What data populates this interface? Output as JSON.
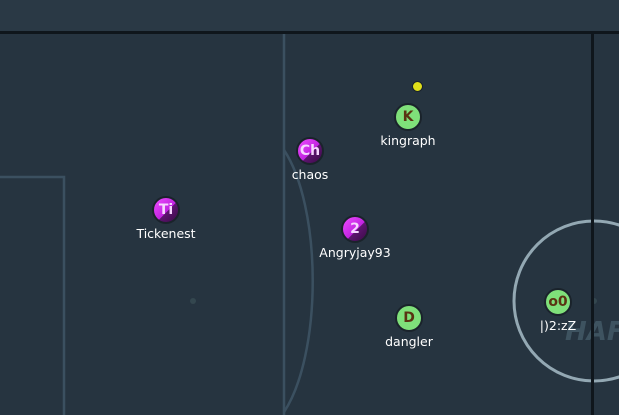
{
  "game": {
    "field_color": "#263440",
    "line_color": "#3b5060",
    "wall_color": "#0f161c",
    "goal_circle_color": "#93a8b3",
    "red_team_color": "#d43df0",
    "blue_team_color": "#7fe07a",
    "ball_color": "#e0df1a"
  },
  "players": [
    {
      "avatar": "K",
      "name": "kingraph",
      "team": "blue"
    },
    {
      "avatar": "Ch",
      "name": "chaos",
      "team": "red"
    },
    {
      "avatar": "Ti",
      "name": "Tickenest",
      "team": "red"
    },
    {
      "avatar": "2",
      "name": "Angryjay93",
      "team": "red"
    },
    {
      "avatar": "D",
      "name": "dangler",
      "team": "blue"
    },
    {
      "avatar": "o0",
      "name": "|)2:zZ",
      "team": "blue"
    }
  ],
  "watermark": "HAFZ"
}
